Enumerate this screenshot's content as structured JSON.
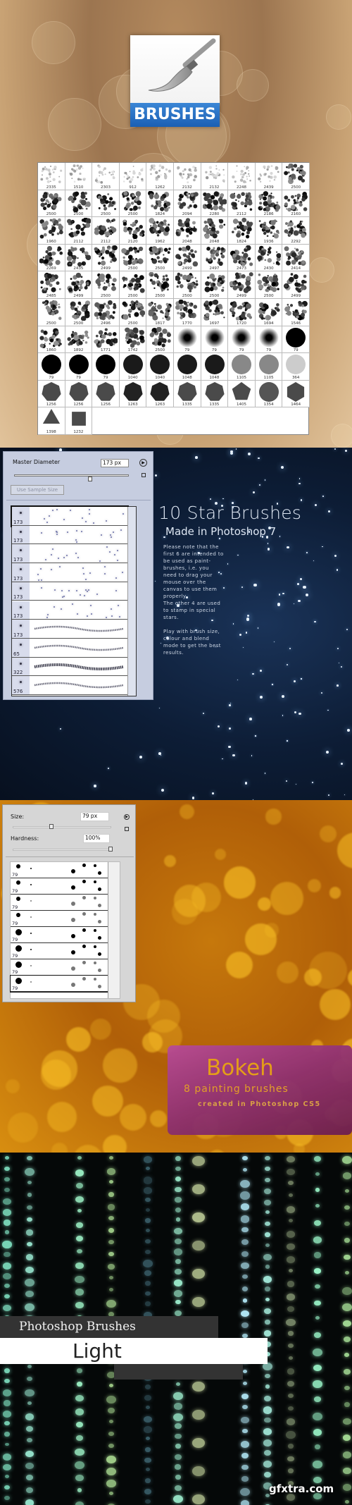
{
  "header_icon": {
    "label": "BRUSHES",
    "icon": "paintbrush-icon",
    "bar_color": "#2a73c6"
  },
  "brush_grid": {
    "cells": [
      [
        "2335",
        "scatter-light"
      ],
      [
        "1510",
        "scatter-light"
      ],
      [
        "2303",
        "scatter-light"
      ],
      [
        "912",
        "scatter-light"
      ],
      [
        "1262",
        "scatter-light"
      ],
      [
        "2132",
        "scatter-light"
      ],
      [
        "2132",
        "scatter-light"
      ],
      [
        "2248",
        "scatter-light"
      ],
      [
        "2439",
        "scatter-light"
      ],
      [
        "2500",
        "scatter"
      ],
      [
        "2500",
        "scatter"
      ],
      [
        "2500",
        "scatter"
      ],
      [
        "2500",
        "scatter"
      ],
      [
        "2500",
        "scatter"
      ],
      [
        "1824",
        "scatter"
      ],
      [
        "2094",
        "scatter"
      ],
      [
        "2280",
        "scatter"
      ],
      [
        "2112",
        "scatter"
      ],
      [
        "2186",
        "scatter"
      ],
      [
        "2160",
        "scatter"
      ],
      [
        "1960",
        "scatter"
      ],
      [
        "2112",
        "scatter"
      ],
      [
        "2112",
        "scatter"
      ],
      [
        "2120",
        "scatter"
      ],
      [
        "1962",
        "scatter"
      ],
      [
        "2048",
        "scatter"
      ],
      [
        "2048",
        "scatter"
      ],
      [
        "1824",
        "scatter"
      ],
      [
        "1936",
        "scatter"
      ],
      [
        "2292",
        "scatter"
      ],
      [
        "2269",
        "scatter"
      ],
      [
        "2435",
        "scatter"
      ],
      [
        "2499",
        "scatter"
      ],
      [
        "2500",
        "scatter"
      ],
      [
        "2500",
        "scatter"
      ],
      [
        "2499",
        "scatter"
      ],
      [
        "2497",
        "scatter"
      ],
      [
        "2473",
        "scatter"
      ],
      [
        "2430",
        "scatter"
      ],
      [
        "2414",
        "scatter"
      ],
      [
        "2485",
        "scatter"
      ],
      [
        "2499",
        "scatter"
      ],
      [
        "2500",
        "scatter"
      ],
      [
        "2500",
        "scatter"
      ],
      [
        "2500",
        "scatter"
      ],
      [
        "2500",
        "scatter"
      ],
      [
        "2500",
        "scatter"
      ],
      [
        "2499",
        "scatter"
      ],
      [
        "2500",
        "scatter"
      ],
      [
        "2499",
        "scatter"
      ],
      [
        "2500",
        "scatter"
      ],
      [
        "2500",
        "scatter"
      ],
      [
        "2496",
        "scatter"
      ],
      [
        "2500",
        "scatter"
      ],
      [
        "1817",
        "scatter"
      ],
      [
        "1770",
        "scatter"
      ],
      [
        "1697",
        "scatter"
      ],
      [
        "1720",
        "scatter"
      ],
      [
        "1694",
        "scatter"
      ],
      [
        "1546",
        "scatter"
      ],
      [
        "1860",
        "scatter"
      ],
      [
        "1892",
        "scatter"
      ],
      [
        "1771",
        "scatter"
      ],
      [
        "1742",
        "scatter"
      ],
      [
        "2500",
        "scatter"
      ],
      [
        "79",
        "soft"
      ],
      [
        "79",
        "soft"
      ],
      [
        "79",
        "soft"
      ],
      [
        "79",
        "soft"
      ],
      [
        "79",
        "circle-black"
      ],
      [
        "79",
        "circle-black"
      ],
      [
        "79",
        "circle-black"
      ],
      [
        "79",
        "circle-black"
      ],
      [
        "1040",
        "circle-dark"
      ],
      [
        "1040",
        "circle-dark"
      ],
      [
        "1048",
        "circle-dark"
      ],
      [
        "1048",
        "circle-dark"
      ],
      [
        "1105",
        "circle-grey"
      ],
      [
        "1105",
        "circle-grey"
      ],
      [
        "364",
        "circle-light"
      ],
      [
        "1256",
        "heptagon"
      ],
      [
        "1256",
        "heptagon"
      ],
      [
        "1256",
        "heptagon"
      ],
      [
        "1263",
        "heptagon-dark"
      ],
      [
        "1263",
        "heptagon-dark"
      ],
      [
        "1335",
        "heptagon"
      ],
      [
        "1335",
        "heptagon"
      ],
      [
        "1405",
        "pentagon"
      ],
      [
        "1354",
        "circle-grey2"
      ],
      [
        "1464",
        "hexagon"
      ],
      [
        "1398",
        "triangle"
      ],
      [
        "1232",
        "square"
      ]
    ]
  },
  "star_panel": {
    "master_diameter_label": "Master Diameter",
    "master_diameter_value": "173 px",
    "slider_fraction": 0.66,
    "use_sample_size_label": "Use Sample Size",
    "presets": [
      "173",
      "173",
      "173",
      "173",
      "173",
      "173",
      "173",
      "65",
      "322",
      "576"
    ]
  },
  "star_text": {
    "title": "10 Star Brushes",
    "subtitle": "Made in Photoshop 7",
    "paragraph1": "Please note that the\nfirst 6 are intended to\nbe used as paint-\nbrushes, i.e. you\nneed to drag your\nmouse over the\ncanvas to use them\nproperly.\nThe other 4 are used\nto stamp in special\nstars.",
    "paragraph2": "Play with brush size,\ncolour and blend\nmode to get the best\nresults."
  },
  "bokeh_panel": {
    "size_label": "Size:",
    "size_value": "79 px",
    "size_slider_fraction": 0.39,
    "hardness_label": "Hardness:",
    "hardness_value": "100%",
    "hardness_slider_fraction": 1.0,
    "presets": [
      "79",
      "79",
      "79",
      "79",
      "79",
      "79",
      "79",
      "79"
    ]
  },
  "bokeh_text": {
    "title": "Bokeh",
    "subtitle": "8 painting brushes",
    "note": "created in Photoshop CS5"
  },
  "light_text": {
    "line1": "Photoshop Brushes",
    "line2": "Light"
  },
  "watermark": "gfxtra.com"
}
